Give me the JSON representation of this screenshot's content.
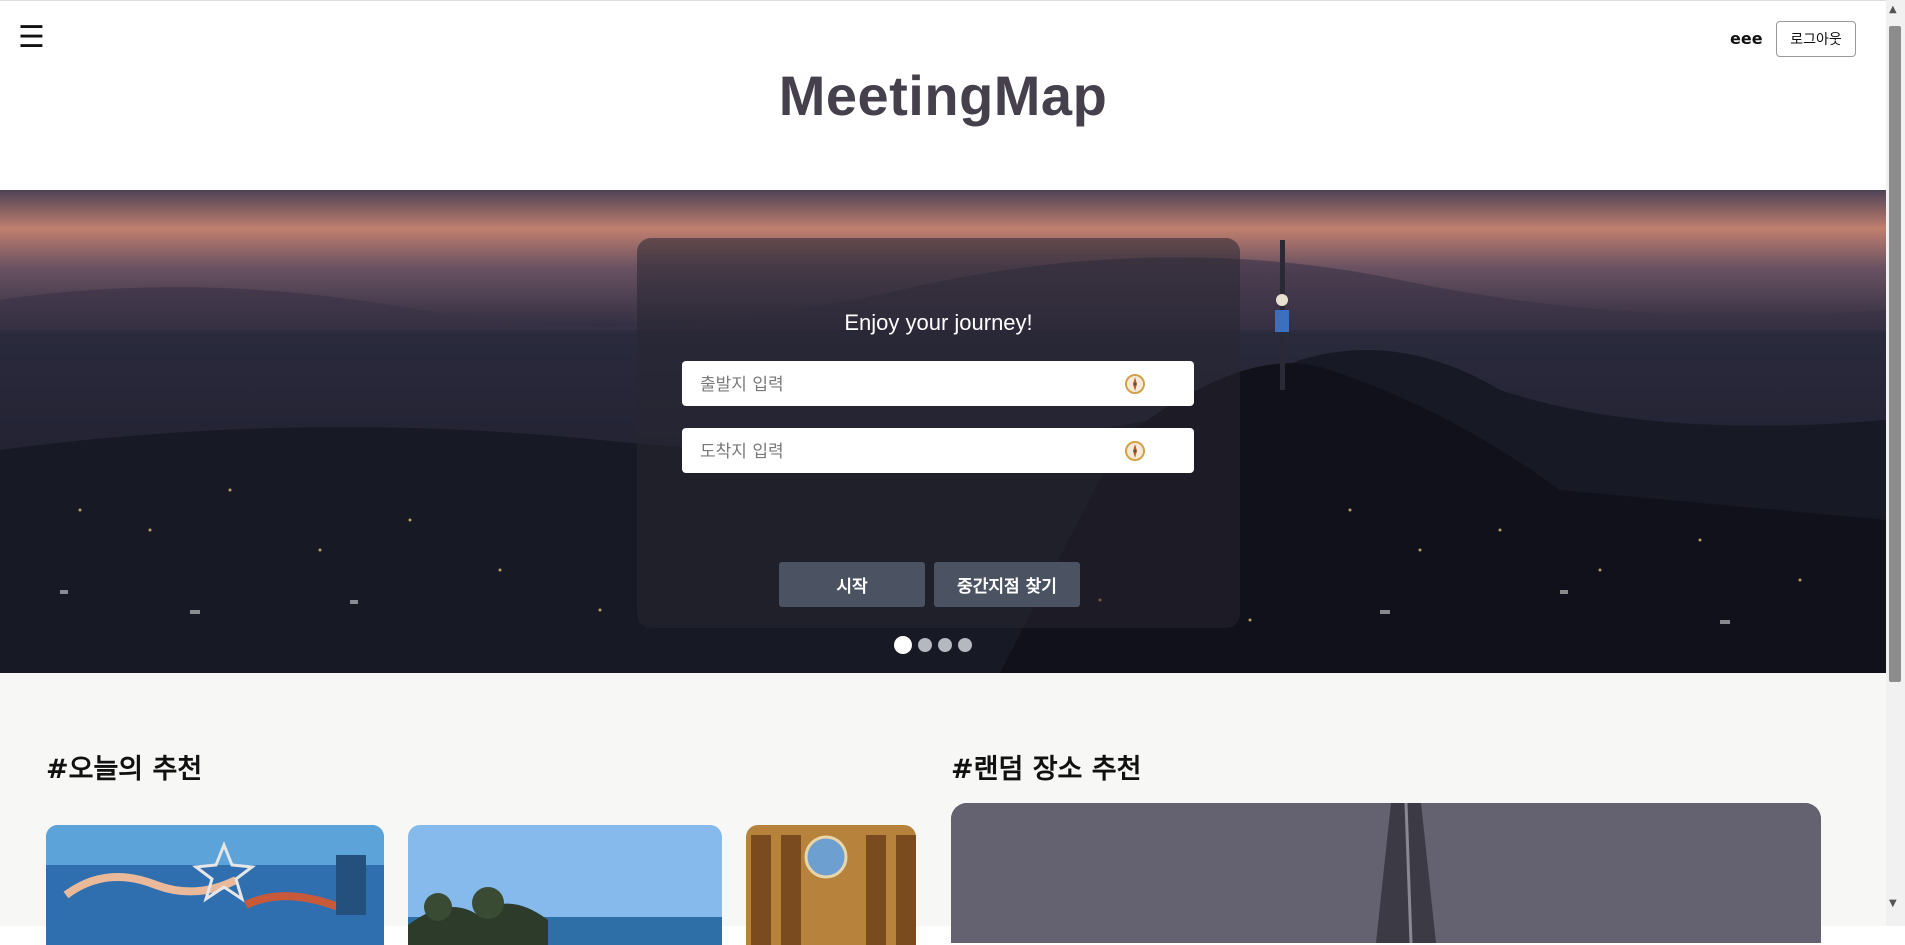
{
  "header": {
    "menu_glyph": "☰",
    "username": "eee",
    "logout_label": "로그아웃",
    "app_title": "MeetingMap"
  },
  "hero": {
    "heading": "Enjoy your journey!",
    "origin_placeholder": "출발지 입력",
    "destination_placeholder": "도착지 입력",
    "start_label": "시작",
    "midpoint_label": "중간지점 찾기",
    "carousel": {
      "total": 4,
      "active_index": 0
    }
  },
  "sections": {
    "today_title": "#오늘의 추천",
    "random_title": "#랜덤 장소 추천"
  },
  "icons": {
    "menu": "hamburger-icon",
    "location": "compass-icon"
  },
  "colors": {
    "title": "#45404b",
    "button": "#4b5363",
    "page_bg": "#f7f7f5"
  }
}
